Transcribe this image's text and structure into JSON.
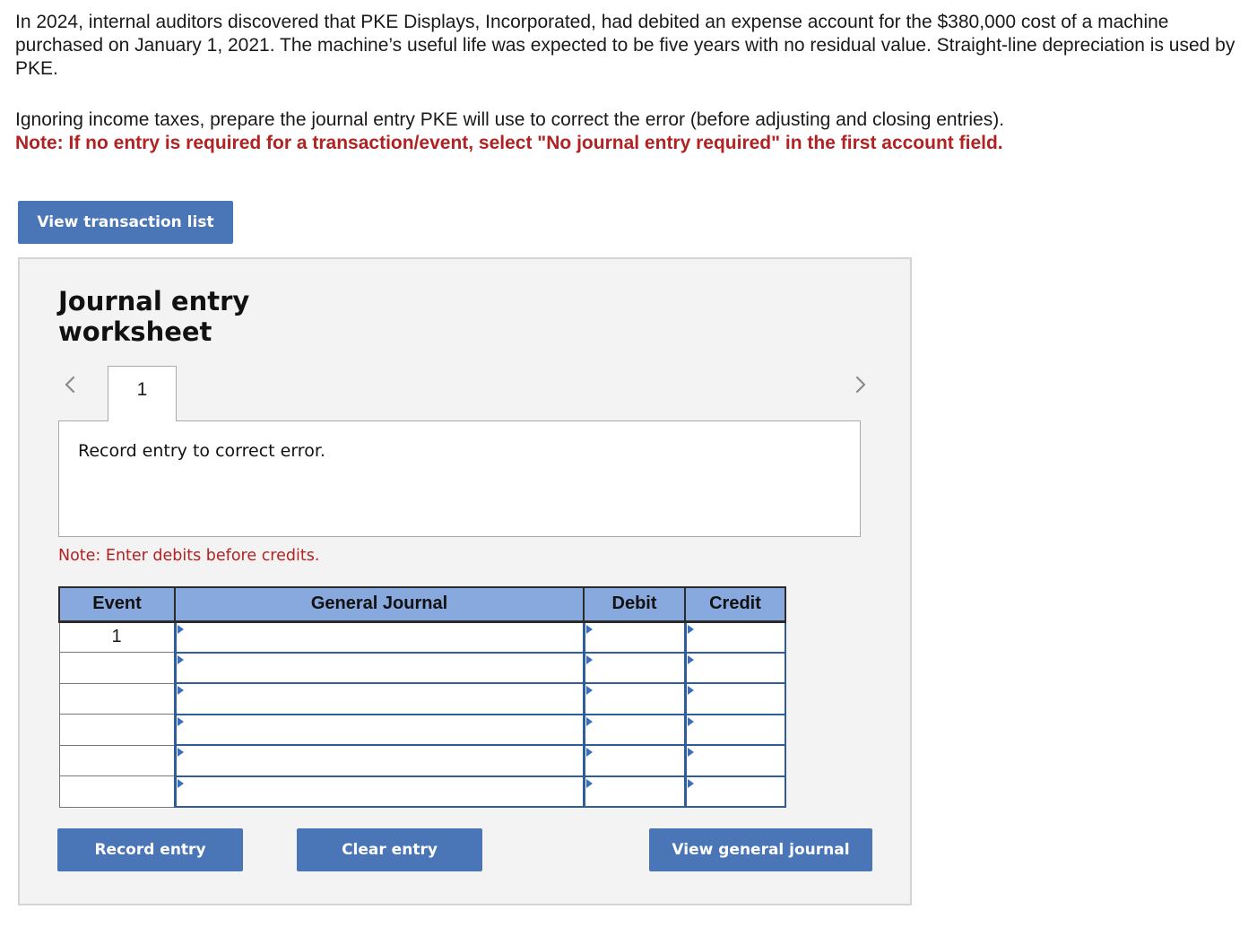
{
  "question": {
    "text": "In 2024, internal auditors discovered that PKE Displays, Incorporated, had debited an expense account for the $380,000 cost of a machine purchased on January 1, 2021. The machine’s useful life was expected to be five years with no residual value. Straight-line depreciation is used by PKE."
  },
  "instruction": {
    "text": "Ignoring income taxes, prepare the journal entry PKE will use to correct the error (before adjusting and closing entries).",
    "note": "Note: If no entry is required for a transaction/event, select \"No journal entry required\" in the first account field."
  },
  "buttons": {
    "view_transaction_list": "View transaction list",
    "record_entry": "Record entry",
    "clear_entry": "Clear entry",
    "view_general_journal": "View general journal"
  },
  "worksheet": {
    "title_line1": "Journal entry",
    "title_line2": "worksheet",
    "prev_icon": "chevron-left-icon",
    "next_icon": "chevron-right-icon",
    "tab_label": "1",
    "entry_description": "Record entry to correct error.",
    "enter_note": "Note: Enter debits before credits."
  },
  "journal_table": {
    "headers": [
      "Event",
      "General Journal",
      "Debit",
      "Credit"
    ],
    "rows": [
      {
        "event": "1",
        "account": "",
        "debit": "",
        "credit": ""
      },
      {
        "event": "",
        "account": "",
        "debit": "",
        "credit": ""
      },
      {
        "event": "",
        "account": "",
        "debit": "",
        "credit": ""
      },
      {
        "event": "",
        "account": "",
        "debit": "",
        "credit": ""
      },
      {
        "event": "",
        "account": "",
        "debit": "",
        "credit": ""
      },
      {
        "event": "",
        "account": "",
        "debit": "",
        "credit": ""
      }
    ]
  },
  "colors": {
    "button_bg": "#4a76b8",
    "header_bg": "#87a9dd",
    "note_red": "#b22222",
    "panel_bg": "#f3f3f3"
  }
}
